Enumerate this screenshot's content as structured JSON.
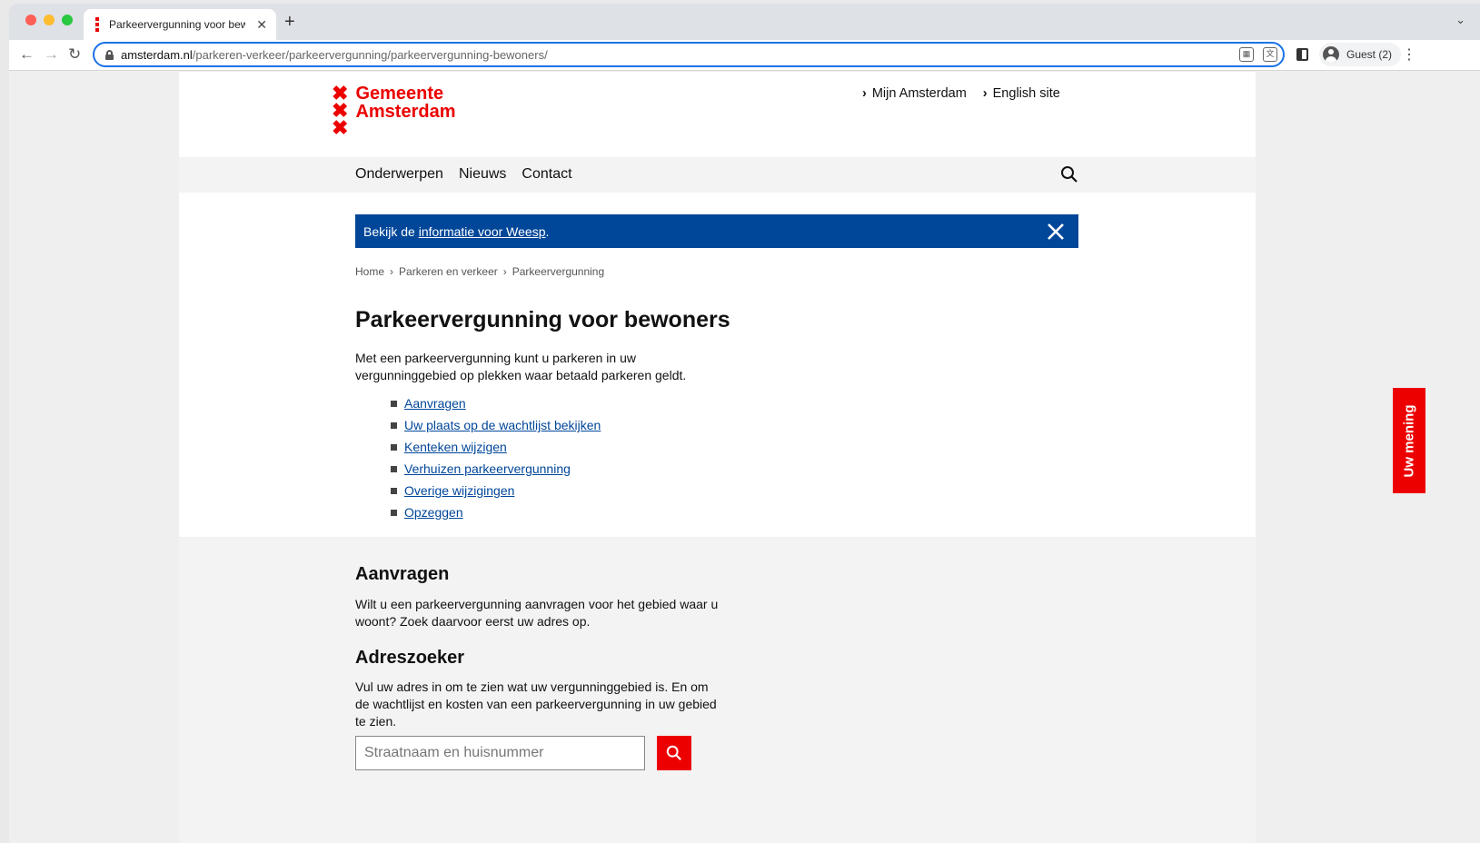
{
  "browser": {
    "tab_title": "Parkeervergunning voor bewoners",
    "new_tab_symbol": "+",
    "url_domain": "amsterdam.nl",
    "url_path": "/parkeren-verkeer/parkeervergunning/parkeervergunning-bewoners/",
    "profile_label": "Guest (2)"
  },
  "header": {
    "logo_line1": "Gemeente",
    "logo_line2": "Amsterdam",
    "top_links": [
      "Mijn Amsterdam",
      "English site"
    ]
  },
  "nav": {
    "items": [
      "Onderwerpen",
      "Nieuws",
      "Contact"
    ]
  },
  "banner": {
    "text_prefix": "Bekijk de ",
    "link_text": "informatie voor Weesp",
    "text_suffix": "."
  },
  "breadcrumb": [
    "Home",
    "Parkeren en verkeer",
    "Parkeervergunning"
  ],
  "main": {
    "title": "Parkeervergunning voor bewoners",
    "intro": "Met een parkeervergunning kunt u parkeren in uw vergunninggebied op plekken waar betaald parkeren geldt.",
    "toc": [
      "Aanvragen",
      "Uw plaats op de wachtlijst bekijken",
      "Kenteken wijzigen",
      "Verhuizen parkeervergunning",
      "Overige wijzigingen",
      "Opzeggen"
    ]
  },
  "aanvragen": {
    "title": "Aanvragen",
    "text": "Wilt u een parkeervergunning aanvragen voor het gebied waar u woont? Zoek daarvoor eerst uw adres op."
  },
  "adreszoeker": {
    "title": "Adreszoeker",
    "text": "Vul uw adres in om te zien wat uw vergunninggebied is. En om de wachtlijst en kosten van een parkeervergunning in uw gebied te zien.",
    "placeholder": "Straatnaam en huisnummer"
  },
  "feedback": {
    "label": "Uw mening"
  },
  "colors": {
    "brand_red": "#ec0000",
    "banner_blue": "#004699"
  }
}
